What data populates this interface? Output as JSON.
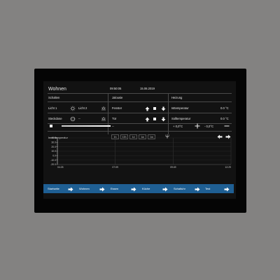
{
  "header": {
    "title": "Wohnen",
    "time": "09:50:05",
    "date": "15.06.2019"
  },
  "sections": {
    "schalten": "Schalten",
    "jalousie": "Jalousie",
    "heizung": "Heizung"
  },
  "lights": {
    "licht1": "Licht 1",
    "licht2": "Licht 2",
    "steckdose": "Steckdose",
    "steckdose_value": "--"
  },
  "jalousie": {
    "fenster": "Fenster",
    "tuer": "Tür"
  },
  "heating": {
    "ist_label": "Isttemperatur",
    "ist_value": "0.0  °C",
    "soll_label": "Solltemperatur",
    "soll_value": "0.0  °C",
    "setpoint_a": "+ 0,0°C",
    "setpoint_b": "- 0,0°C"
  },
  "dimmer": {
    "value": "--"
  },
  "chart_controls": {
    "label": "Innentemperatur",
    "ranges": [
      "1h",
      "12h",
      "1d",
      "1w",
      "1m"
    ]
  },
  "chart_data": {
    "type": "line",
    "title": "Innentemperatur",
    "xlabel": "",
    "ylabel": "",
    "x_ticks": [
      "04:25",
      "07:09",
      "09:49",
      "12:29"
    ],
    "y_ticks": [
      "40.0",
      "30.0",
      "20.0",
      "10.0",
      "0.0",
      "-10.0",
      "-20.0"
    ],
    "ylim": [
      -20,
      40
    ],
    "grid": true,
    "series": []
  },
  "nav": {
    "items": [
      "Startseite",
      "Wohnen",
      "Essen",
      "Küche",
      "Schaltuhr",
      "Test"
    ]
  },
  "colors": {
    "nav_bg": "#1f5f93",
    "screen_bg": "#121212",
    "frame": "#838281"
  }
}
